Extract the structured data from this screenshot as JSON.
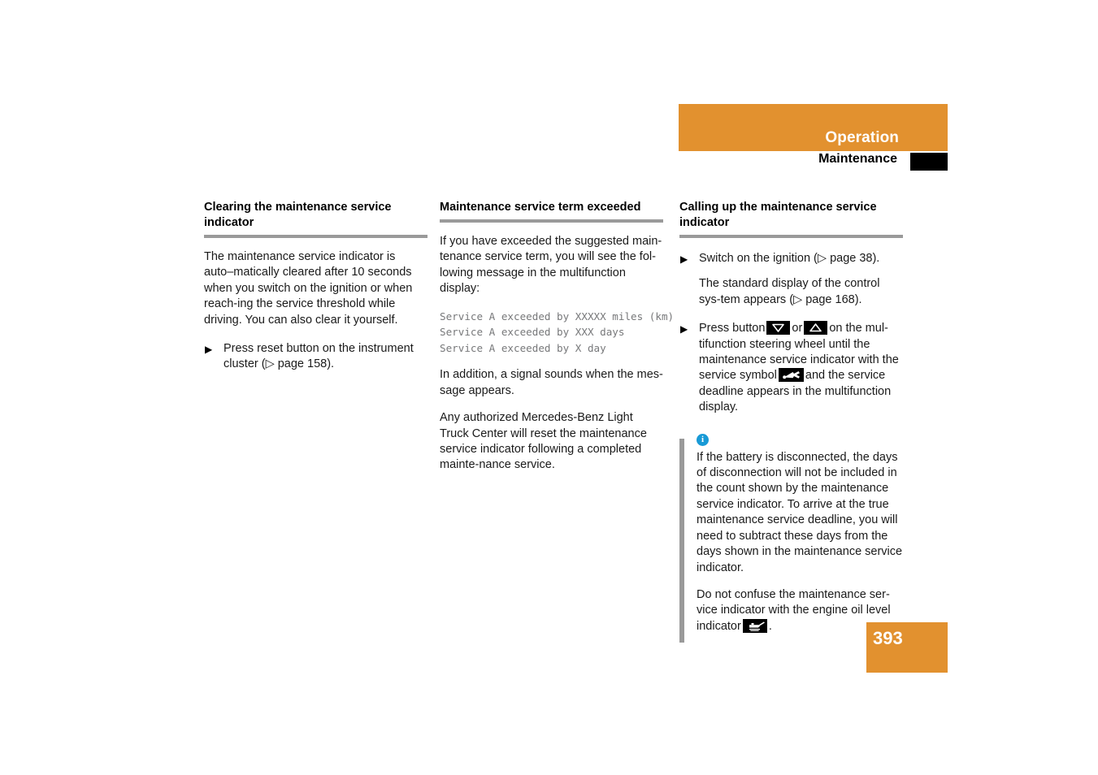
{
  "header": {
    "chapter": "Operation",
    "section": "Maintenance"
  },
  "columns": [
    {
      "heading": "Clearing the maintenance service indicator",
      "paragraph": "The maintenance service indicator is auto–matically cleared after 10 seconds when you switch on the ignition or when reach‐ing the service threshold while driving. You can also clear it yourself.",
      "step_marker": "▶",
      "step": "Press reset button on the instrument cluster (▷ page 158)."
    },
    {
      "heading": "Maintenance service term exceeded",
      "paragraph_1": "If you have exceeded the suggested main‐tenance service term, you will see the fol‐lowing message in the multifunction display:",
      "display_lines": "Service A exceeded by XXXXX miles (km)\nService A exceeded by XXX days\nService A exceeded by X day",
      "paragraph_2": "In addition, a signal sounds when the mes‐sage appears.",
      "paragraph_3": "Any authorized Mercedes-Benz Light Truck Center will reset the maintenance service indicator following a completed mainte‐nance service."
    },
    {
      "heading": "Calling up the maintenance service indicator",
      "step_marker": "▶",
      "step_1": "Switch on the ignition (▷ page 38).",
      "step_1_sub": "The standard display of the control sys‐tem appears (▷ page 168).",
      "step_2_part_1": "Press button",
      "step_2_part_2": "or",
      "step_2_part_3": "on the mul‐tifunction steering wheel until the maintenance service indicator with the service symbol",
      "step_2_part_4": "and the service deadline appears in the multifunction display.",
      "icons": {
        "button_down": "arrow-down-button-icon",
        "button_up": "arrow-up-button-icon",
        "service_symbol": "wrench-icon",
        "oil_level": "oil-can-icon"
      },
      "note": {
        "icon": "info-icon",
        "icon_label": "i",
        "paragraph_1": "If the battery is disconnected, the days of disconnection will not be included in the count shown by the maintenance service indicator. To arrive at the true maintenance service deadline, you will need to subtract these days from the days shown in the maintenance service indicator.",
        "paragraph_2_part_1": "Do not confuse the maintenance ser‐vice indicator with the engine oil level indicator",
        "paragraph_2_part_2": "."
      }
    }
  ],
  "page_number": "393",
  "colors": {
    "accent_orange": "#e2912f",
    "rule_gray": "#9a9a9a",
    "mono_gray": "#77787a",
    "info_blue": "#189ad6"
  }
}
